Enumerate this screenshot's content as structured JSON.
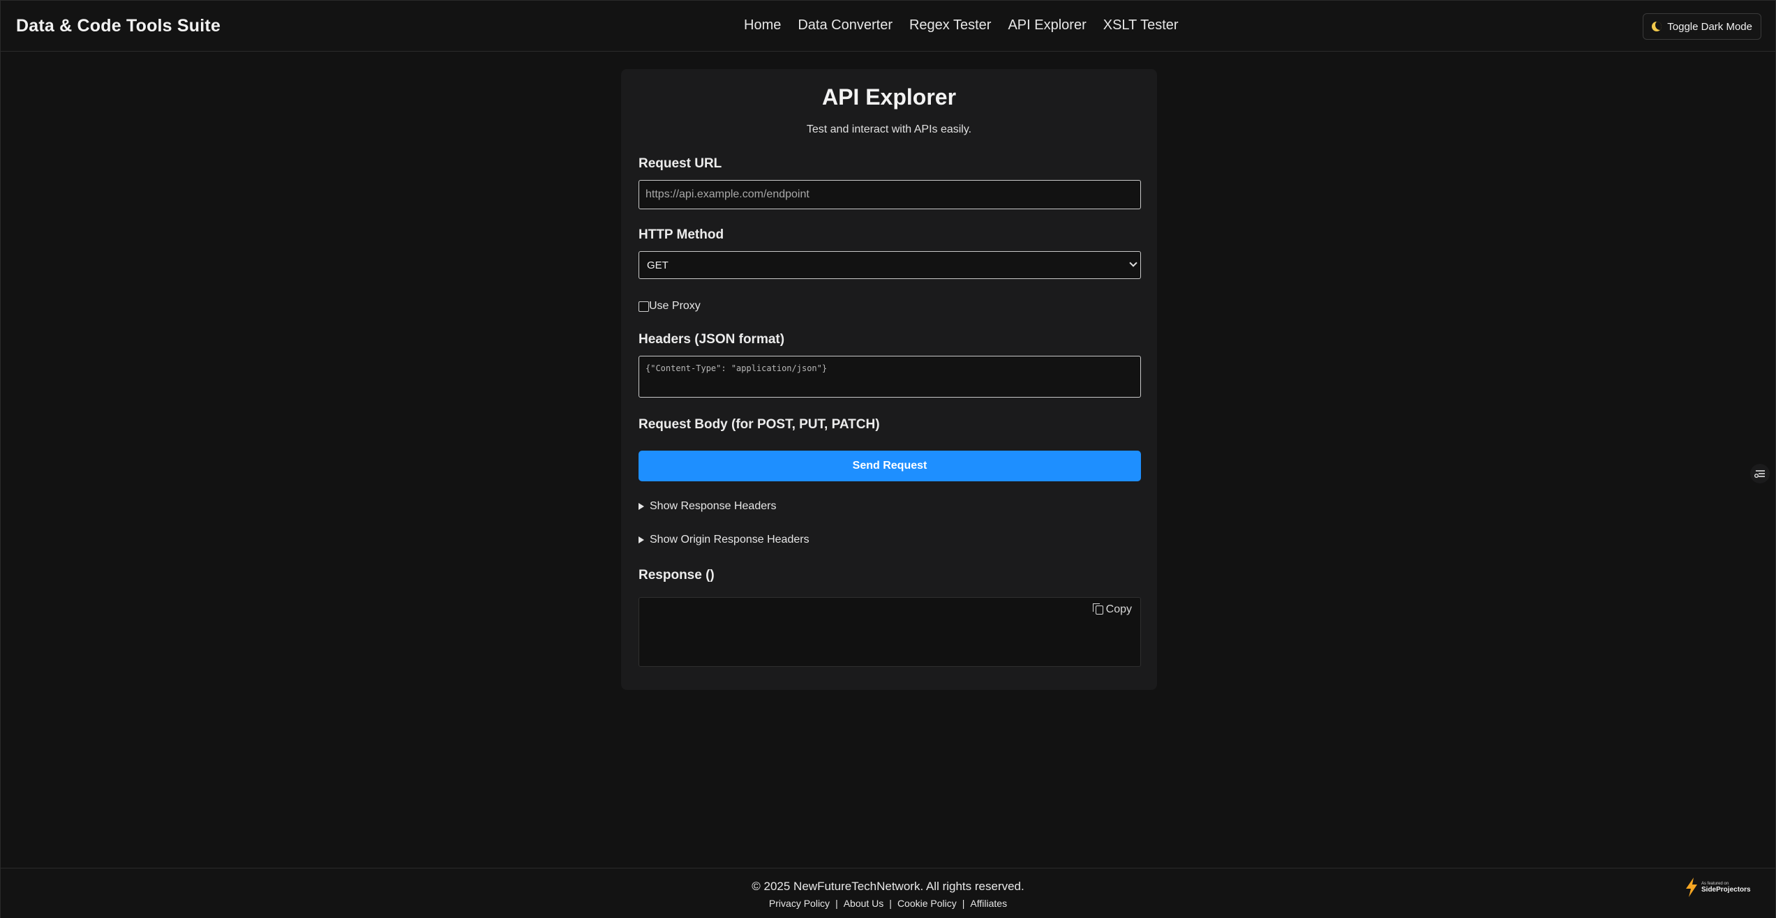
{
  "header": {
    "brand": "Data & Code Tools Suite",
    "nav": [
      "Home",
      "Data Converter",
      "Regex Tester",
      "API Explorer",
      "XSLT Tester"
    ],
    "toggle_label": "Toggle Dark Mode",
    "toggle_icon": "moon-icon"
  },
  "main": {
    "title": "API Explorer",
    "subtitle": "Test and interact with APIs easily.",
    "request_url_label": "Request URL",
    "request_url_placeholder": "https://api.example.com/endpoint",
    "request_url_value": "",
    "method_label": "HTTP Method",
    "method_selected": "GET",
    "use_proxy_label": "Use Proxy",
    "use_proxy_checked": false,
    "headers_label": "Headers (JSON format)",
    "headers_placeholder": "{\"Content-Type\": \"application/json\"}",
    "body_label": "Request Body (for POST, PUT, PATCH)",
    "send_label": "Send Request",
    "show_response_headers": "Show Response Headers",
    "show_origin_response_headers": "Show Origin Response Headers",
    "response_label": "Response ()",
    "copy_label": "Copy"
  },
  "footer": {
    "copyright": "© 2025 NewFutureTechNetwork. All rights reserved.",
    "links": [
      "Privacy Policy",
      "About Us",
      "Cookie Policy",
      "Affiliates"
    ],
    "separator": "|",
    "badge_small": "As featured on",
    "badge_name": "SideProjectors"
  },
  "colors": {
    "background": "#121212",
    "card": "#1b1b1c",
    "accent": "#1e8fff",
    "badge_bolt": "#f5a623"
  }
}
